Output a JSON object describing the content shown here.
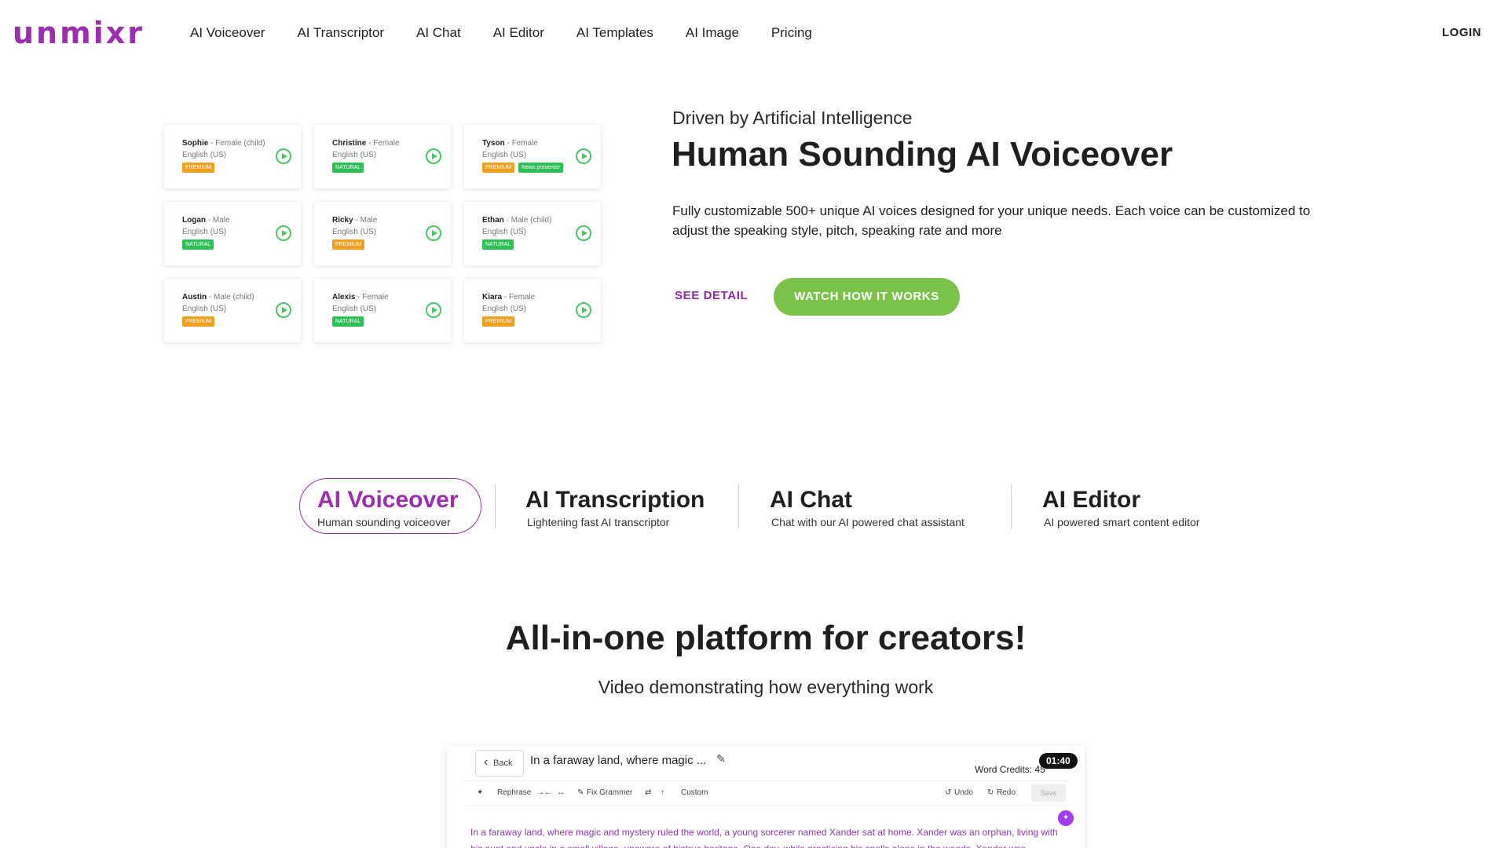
{
  "header": {
    "logo": "unmixr",
    "nav": [
      "AI Voiceover",
      "AI Transcriptor",
      "AI Chat",
      "AI Editor",
      "AI Templates",
      "AI Image",
      "Pricing"
    ],
    "login": "LOGIN"
  },
  "voices": [
    {
      "name": "Sophie",
      "gender": " - Female (child)",
      "lang": "English (US)",
      "tags": [
        "PREMIUM"
      ]
    },
    {
      "name": "Christine",
      "gender": " - Female",
      "lang": "English (US)",
      "tags": [
        "NATURAL"
      ]
    },
    {
      "name": "Tyson",
      "gender": " - Female",
      "lang": "English (US)",
      "tags": [
        "PREMIUM",
        "News presenter"
      ]
    },
    {
      "name": "Logan",
      "gender": " - Male",
      "lang": "English (US)",
      "tags": [
        "NATURAL"
      ]
    },
    {
      "name": "Ricky",
      "gender": " - Male",
      "lang": "English (US)",
      "tags": [
        "PREMIUM"
      ]
    },
    {
      "name": "Ethan",
      "gender": " - Male (child)",
      "lang": "English (US)",
      "tags": [
        "NATURAL"
      ]
    },
    {
      "name": "Austin",
      "gender": " - Male (child)",
      "lang": "English (US)",
      "tags": [
        "PREMIUM"
      ]
    },
    {
      "name": "Alexis",
      "gender": " - Female",
      "lang": "English (US)",
      "tags": [
        "NATURAL"
      ]
    },
    {
      "name": "Kiara",
      "gender": " - Female",
      "lang": "English (US)",
      "tags": [
        "PREMIUM"
      ]
    }
  ],
  "hero": {
    "subtitle": "Driven by Artificial Intelligence",
    "title": "Human Sounding AI Voiceover",
    "description": "Fully customizable 500+ unique AI voices designed for your unique needs. Each voice can be customized to adjust the speaking style, pitch, speaking rate and more",
    "see_detail": "SEE DETAIL",
    "watch": "WATCH HOW IT WORKS"
  },
  "tabs": [
    {
      "title": "AI Voiceover",
      "desc": "Human sounding voiceover",
      "active": true
    },
    {
      "title": "AI Transcription",
      "desc": "Lightening fast AI transcriptor",
      "active": false
    },
    {
      "title": "AI Chat",
      "desc": "Chat with our AI powered chat assistant",
      "active": false
    },
    {
      "title": "AI Editor",
      "desc": "AI powered smart content editor",
      "active": false
    }
  ],
  "platform": {
    "title": "All-in-one platform for creators!",
    "subtitle": "Video demonstrating how everything work"
  },
  "editor": {
    "back": "Back",
    "doc_title": "In a faraway land, where magic ...",
    "credits": "Word Credits: 45",
    "timer": "01:40",
    "toolbar": {
      "rephrase": "Rephrase",
      "fix_grammar": "Fix Grammer",
      "custom": "Custom",
      "undo": "Undo",
      "redo": "Redo",
      "save": "Save"
    },
    "text": "In a faraway land, where magic and mystery ruled the world, a young sorcerer named Xander sat at home. Xander was an orphan, living with his aunt and uncle in a small village, unaware of histrue heritage. One day, while practicing his spells alone in the woods, Xander was"
  },
  "colors": {
    "brand": "#9b2fae",
    "accent_green": "#7bc24a",
    "premium": "#f0a020",
    "natural": "#2fbf57"
  }
}
